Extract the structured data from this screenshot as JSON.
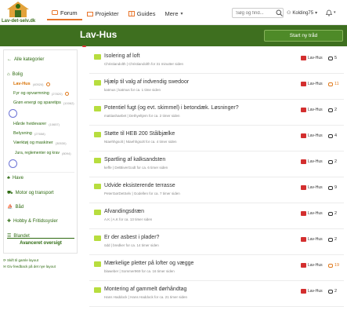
{
  "header": {
    "logo_text": "Lav-det-selv.dk",
    "nav": [
      {
        "label": "Forum",
        "active": true
      },
      {
        "label": "Projekter",
        "active": false
      },
      {
        "label": "Guides",
        "active": false
      },
      {
        "label": "Mere",
        "active": false
      }
    ],
    "search_placeholder": "Søg og find...",
    "user": "Kolding75"
  },
  "page": {
    "title": "Lav-Hus",
    "new_thread_label": "Start ny tråd"
  },
  "sidebar": {
    "all_categories": "Alle kategorier",
    "bolig": "Bolig",
    "lav_hus": "Lav-Hus",
    "lav_hus_count": "(40524)",
    "sub1": "Fyr og opvarmning",
    "sub1_count": "(27820)",
    "sub2": "Grøn energi og sparetips",
    "sub2_count": "(10062)",
    "sub3": "Hårde hvidevarer",
    "sub3_count": "(10657)",
    "sub4": "Belysning",
    "sub4_count": "(27658)",
    "sub5": "Værktøj og maskiner",
    "sub5_count": "(30530)",
    "sub6": "Jura, reglementer og krav",
    "sub6_count": "(8094)",
    "have": "Have",
    "motor": "Motor og transport",
    "baad": "Båd",
    "hobby": "Hobby & Fritidssysler",
    "blandet": "Blandet",
    "advanced": "Avanceret oversigt",
    "footer1": "Skift til gamle layout",
    "footer2": "Giv feedback på det nye layout"
  },
  "threads": [
    {
      "title": "Isolering af loft",
      "meta": "Christiandolth | Christiandolth for 31 minutter siden",
      "forum": "Lav-Hus",
      "replies": "5",
      "hot": false
    },
    {
      "title": "Hjælp til valg af indvendig swedoor",
      "meta": "katmus | katmus for ca. 1 time siden",
      "forum": "Lav-Hus",
      "replies": "11",
      "hot": true
    },
    {
      "title": "Potentiel fugt (og evt. skimmel) i betondæk. Løsninger?",
      "meta": "mattiashaebet | Dethyeltjem for ca. 2 timer siden",
      "forum": "Lav-Hus",
      "replies": "2",
      "hot": false
    },
    {
      "title": "Støtte til HEB 200 Stålbjælke",
      "meta": "Ntaehhgsolt | Ntaehhgsolt for ca. 4 timer siden",
      "forum": "Lav-Hus",
      "replies": "4",
      "hot": false
    },
    {
      "title": "Spartling af kalksandsten",
      "meta": "keffe | DetBiverGodt for ca. 6 timer siden",
      "forum": "Lav-Hus",
      "replies": "2",
      "hot": false
    },
    {
      "title": "Udvide eksisterende terrasse",
      "meta": "PeterGørDetSelv | Godellen for ca. 7 timer siden",
      "forum": "Lav-Hus",
      "replies": "9",
      "hot": false
    },
    {
      "title": "Afvandingsdræn",
      "meta": "A.K | A.K for ca. 13 timer siden",
      "forum": "Lav-Hus",
      "replies": "2",
      "hot": false
    },
    {
      "title": "Er der asbest i plader?",
      "meta": "ödd | bredker for ca. 14 timer siden",
      "forum": "Lav-Hus",
      "replies": "2",
      "hot": false
    },
    {
      "title": "Mærkelige pletter på lofter og vægge",
      "meta": "blaweber | Sommer969 for ca. 16 timer siden",
      "forum": "Lav-Hus",
      "replies": "19",
      "hot": true
    },
    {
      "title": "Montering af gammelt dørhåndtag",
      "meta": "Hans Haddock | Hans Haddock for ca. 21 timer siden",
      "forum": "Lav-Hus",
      "replies": "2",
      "hot": false
    }
  ],
  "colors": {
    "brand_green": "#3e6f1f",
    "accent_orange": "#e07b1f",
    "forum_red": "#d32f2f"
  }
}
